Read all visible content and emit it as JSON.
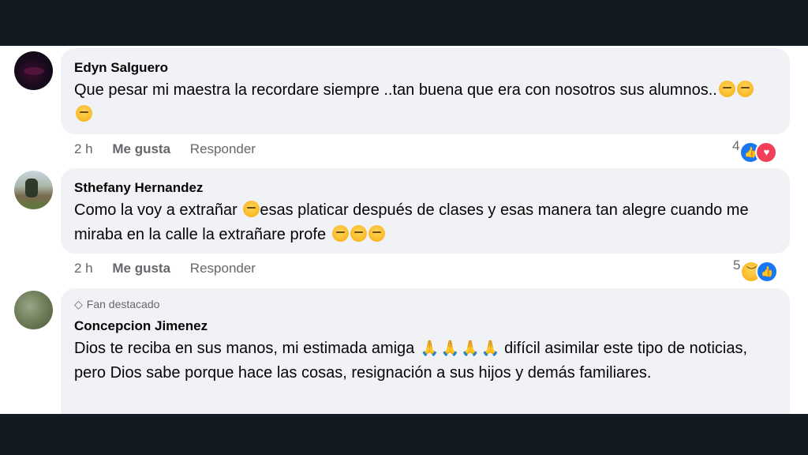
{
  "comments": [
    {
      "author": "Edyn Salguero",
      "text": "Que pesar mi maestra la recordare siempre ..tan buena que era con nosotros sus alumnos..",
      "time": "2 h",
      "like_label": "Me gusta",
      "reply_label": "Responder",
      "reaction_count": "4",
      "reactions": [
        "like-icon",
        "love-icon"
      ]
    },
    {
      "author": "Sthefany Hernandez",
      "text_a": "Como la voy a extrañar ",
      "text_b": "esas platicar después de clases y esas manera tan alegre cuando me miraba en la calle la extrañare profe ",
      "time": "2 h",
      "like_label": "Me gusta",
      "reply_label": "Responder",
      "reaction_count": "5",
      "reactions": [
        "sad-icon",
        "like-icon"
      ]
    },
    {
      "badge": "Fan destacado",
      "author": "Concepcion Jimenez",
      "text_a": "Dios te reciba en sus manos, mi estimada amiga ",
      "text_b": " difícil asimilar este tipo de noticias, pero Dios sabe porque hace las cosas, resignación a sus hijos y demás familiares."
    }
  ],
  "colors": {
    "bubble": "#f0f2f5",
    "meta": "#65676b",
    "like_blue": "#1877f2",
    "love_red": "#f33e58",
    "frame": "#121a22"
  }
}
